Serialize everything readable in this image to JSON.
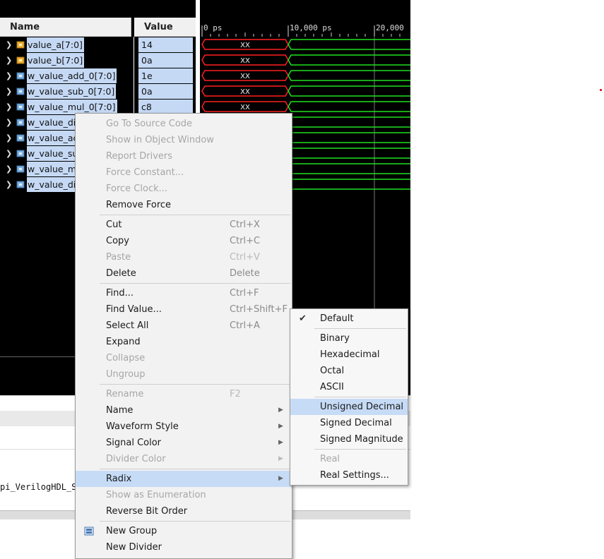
{
  "signal_table": {
    "name_header": "Name",
    "value_header": "Value",
    "signals": [
      {
        "name": "value_a[7:0]",
        "value": "14",
        "type": "input"
      },
      {
        "name": "value_b[7:0]",
        "value": "0a",
        "type": "input"
      },
      {
        "name": "w_value_add_0[7:0]",
        "value": "1e",
        "type": "wire"
      },
      {
        "name": "w_value_sub_0[7:0]",
        "value": "0a",
        "type": "wire"
      },
      {
        "name": "w_value_mul_0[7:0]",
        "value": "c8",
        "type": "wire"
      },
      {
        "name": "w_value_di",
        "value": "",
        "type": "wire"
      },
      {
        "name": "w_value_ac",
        "value": "",
        "type": "wire"
      },
      {
        "name": "w_value_su",
        "value": "",
        "type": "wire"
      },
      {
        "name": "w_value_m",
        "value": "",
        "type": "wire"
      },
      {
        "name": "w_value_di",
        "value": "",
        "type": "wire"
      }
    ]
  },
  "waveform": {
    "time_labels": [
      "0 ps",
      "10,000 ps",
      "20,000"
    ],
    "unknown_label": "XX",
    "colors": {
      "unknown": "#ff2020",
      "valid": "#20e020",
      "cursor": "#888888"
    }
  },
  "console": {
    "text": "pi_VerilogHDL_Se"
  },
  "context_menu": {
    "items": [
      {
        "label": "Go To Source Code",
        "shortcut": "",
        "disabled": true
      },
      {
        "label": "Show in Object Window",
        "shortcut": "",
        "disabled": true
      },
      {
        "label": "Report Drivers",
        "shortcut": "",
        "disabled": true
      },
      {
        "label": "Force Constant...",
        "shortcut": "",
        "disabled": true
      },
      {
        "label": "Force Clock...",
        "shortcut": "",
        "disabled": true
      },
      {
        "label": "Remove Force",
        "shortcut": "",
        "disabled": false
      },
      {
        "label": "Cut",
        "shortcut": "Ctrl+X",
        "disabled": false
      },
      {
        "label": "Copy",
        "shortcut": "Ctrl+C",
        "disabled": false
      },
      {
        "label": "Paste",
        "shortcut": "Ctrl+V",
        "disabled": true
      },
      {
        "label": "Delete",
        "shortcut": "Delete",
        "disabled": false
      },
      {
        "label": "Find...",
        "shortcut": "Ctrl+F",
        "disabled": false
      },
      {
        "label": "Find Value...",
        "shortcut": "Ctrl+Shift+F",
        "disabled": false
      },
      {
        "label": "Select All",
        "shortcut": "Ctrl+A",
        "disabled": false
      },
      {
        "label": "Expand",
        "shortcut": "",
        "disabled": false
      },
      {
        "label": "Collapse",
        "shortcut": "",
        "disabled": true
      },
      {
        "label": "Ungroup",
        "shortcut": "",
        "disabled": true
      },
      {
        "label": "Rename",
        "shortcut": "F2",
        "disabled": true
      },
      {
        "label": "Name",
        "shortcut": "",
        "disabled": false
      },
      {
        "label": "Waveform Style",
        "shortcut": "",
        "disabled": false
      },
      {
        "label": "Signal Color",
        "shortcut": "",
        "disabled": false
      },
      {
        "label": "Divider Color",
        "shortcut": "",
        "disabled": true
      },
      {
        "label": "Radix",
        "shortcut": "",
        "disabled": false
      },
      {
        "label": "Show as Enumeration",
        "shortcut": "",
        "disabled": true
      },
      {
        "label": "Reverse Bit Order",
        "shortcut": "",
        "disabled": false
      },
      {
        "label": "New Group",
        "shortcut": "",
        "disabled": false
      },
      {
        "label": "New Divider",
        "shortcut": "",
        "disabled": false
      }
    ]
  },
  "radix_submenu": {
    "items": [
      {
        "label": "Default",
        "checked": true,
        "disabled": false
      },
      {
        "label": "Binary",
        "checked": false,
        "disabled": false
      },
      {
        "label": "Hexadecimal",
        "checked": false,
        "disabled": false
      },
      {
        "label": "Octal",
        "checked": false,
        "disabled": false
      },
      {
        "label": "ASCII",
        "checked": false,
        "disabled": false
      },
      {
        "label": "Unsigned Decimal",
        "checked": false,
        "disabled": false
      },
      {
        "label": "Signed Decimal",
        "checked": false,
        "disabled": false
      },
      {
        "label": "Signed Magnitude",
        "checked": false,
        "disabled": false
      },
      {
        "label": "Real",
        "checked": false,
        "disabled": true
      },
      {
        "label": "Real Settings...",
        "checked": false,
        "disabled": false
      }
    ]
  }
}
